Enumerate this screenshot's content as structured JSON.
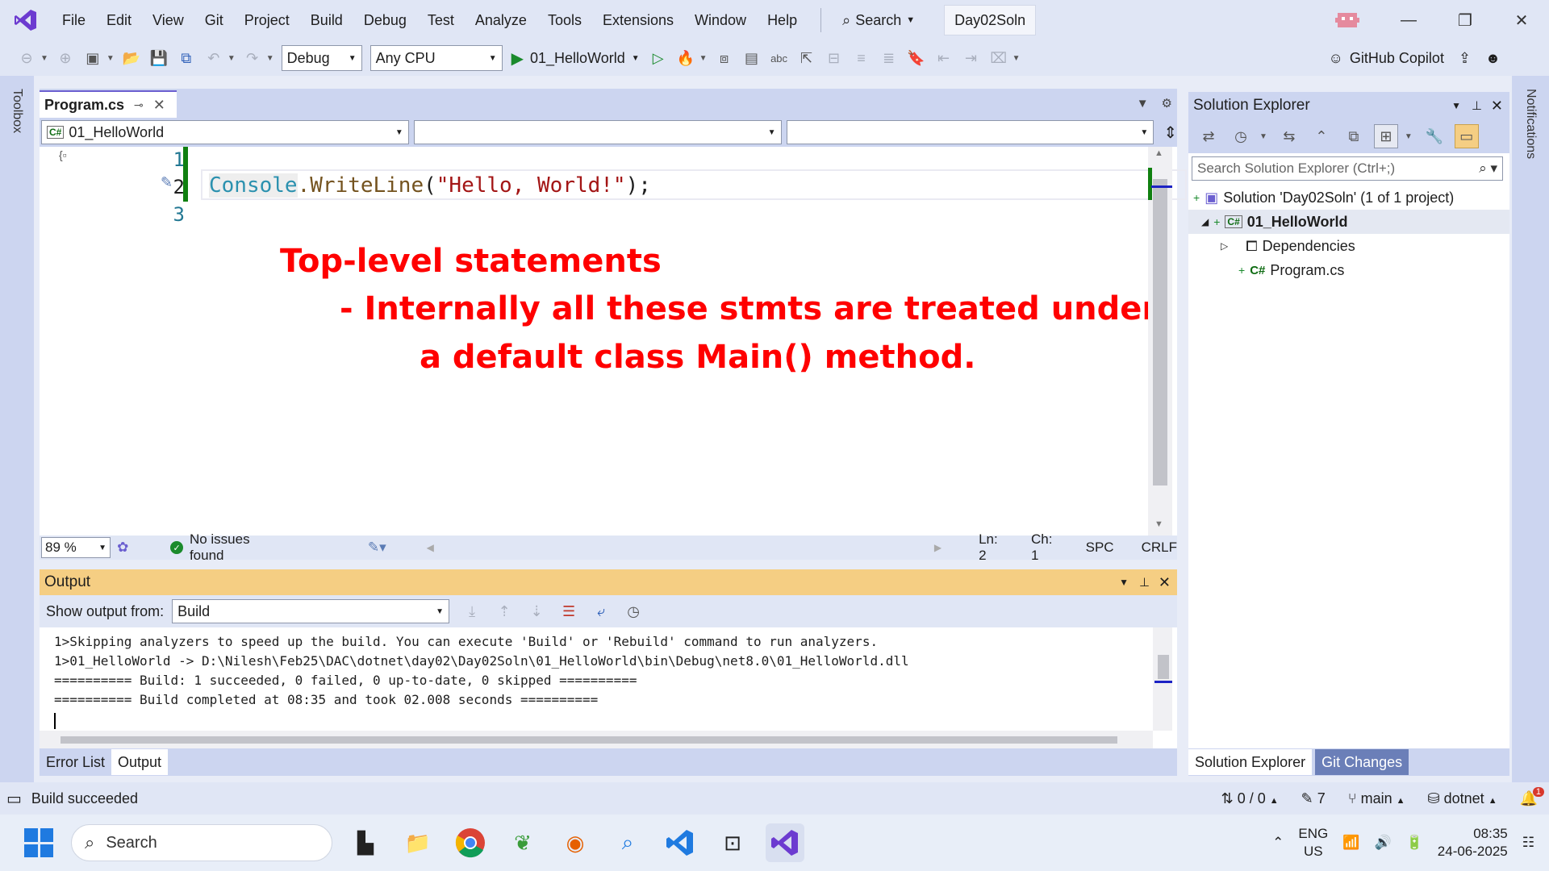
{
  "menu": {
    "items": [
      "File",
      "Edit",
      "View",
      "Git",
      "Project",
      "Build",
      "Debug",
      "Test",
      "Analyze",
      "Tools",
      "Extensions",
      "Window",
      "Help"
    ],
    "search_label": "Search",
    "solution_name": "Day02Soln"
  },
  "toolbar": {
    "config": "Debug",
    "platform": "Any CPU",
    "startup_project": "01_HelloWorld",
    "copilot_label": "GitHub Copilot"
  },
  "rails": {
    "toolbox": "Toolbox",
    "notifications": "Notifications"
  },
  "editor": {
    "tab_title": "Program.cs",
    "nav_project": "01_HelloWorld",
    "lines": [
      "1",
      "2",
      "3"
    ],
    "code_line2": {
      "class_tok": "Console",
      "dot_method": ".WriteLine",
      "open": "(",
      "string_tok": "\"Hello, World!\"",
      "close": ");"
    },
    "annotation": {
      "line1": "Top-level statements",
      "line2": "- Internally all these stmts are treated under",
      "line3": "a default class Main() method."
    },
    "status": {
      "zoom": "89 %",
      "issues": "No issues found",
      "ln": "Ln: 2",
      "ch": "Ch: 1",
      "spc": "SPC",
      "eol": "CRLF"
    }
  },
  "output": {
    "title": "Output",
    "show_from_label": "Show output from:",
    "show_from_value": "Build",
    "lines": [
      "1>Skipping analyzers to speed up the build. You can execute 'Build' or 'Rebuild' command to run analyzers.",
      "1>01_HelloWorld -> D:\\Nilesh\\Feb25\\DAC\\dotnet\\day02\\Day02Soln\\01_HelloWorld\\bin\\Debug\\net8.0\\01_HelloWorld.dll",
      "========== Build: 1 succeeded, 0 failed, 0 up-to-date, 0 skipped ==========",
      "========== Build completed at 08:35 and took 02.008 seconds =========="
    ],
    "tabs": [
      "Error List",
      "Output"
    ],
    "active_tab": "Output"
  },
  "solution_explorer": {
    "title": "Solution Explorer",
    "search_placeholder": "Search Solution Explorer (Ctrl+;)",
    "tree": {
      "solution": "Solution 'Day02Soln' (1 of 1 project)",
      "project": "01_HelloWorld",
      "dependencies": "Dependencies",
      "file": "Program.cs"
    },
    "tabs": [
      "Solution Explorer",
      "Git Changes"
    ]
  },
  "statusbar": {
    "message": "Build succeeded",
    "changes": "0 / 0",
    "edits": "7",
    "branch": "main",
    "repo": "dotnet",
    "notif_count": "1"
  },
  "taskbar": {
    "search": "Search",
    "lang1": "ENG",
    "lang2": "US",
    "time": "08:35",
    "date": "24-06-2025"
  },
  "colors": {
    "accent": "#6b5fd0",
    "annotation": "#ff0000",
    "output_header": "#f5ce83",
    "change_bar": "#108010"
  }
}
